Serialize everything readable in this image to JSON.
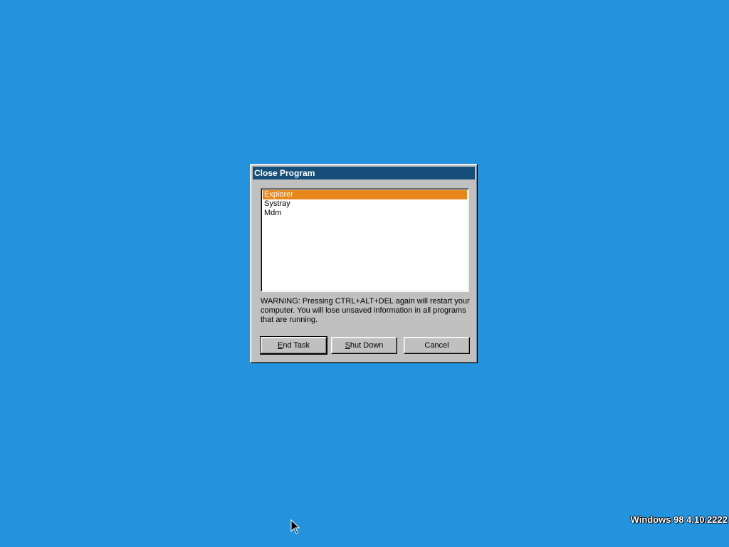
{
  "dialog": {
    "title": "Close Program",
    "processes": [
      {
        "name": "Explorer",
        "selected": true
      },
      {
        "name": "Systray",
        "selected": false
      },
      {
        "name": "Mdm",
        "selected": false
      }
    ],
    "warning": "WARNING: Pressing CTRL+ALT+DEL again will restart your computer. You will lose unsaved information in all programs that are running.",
    "buttons": {
      "end_task": {
        "mnemonic": "E",
        "rest": "nd Task"
      },
      "shut_down": {
        "mnemonic": "S",
        "rest": "hut Down"
      },
      "cancel": {
        "label": "Cancel"
      }
    }
  },
  "desktop": {
    "version_text": "Windows 98 4.10.2222",
    "background_color": "#2393dd"
  },
  "colors": {
    "titlebar": "#164e7a",
    "selection": "#e8861a",
    "face": "#c0c0c0"
  },
  "icons": {
    "cursor": "arrow-pointer-icon"
  }
}
